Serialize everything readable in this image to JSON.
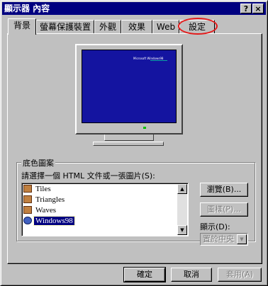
{
  "window": {
    "title": "顯示器 內容",
    "help_button": "?",
    "close_button": "×"
  },
  "tabs": [
    {
      "label": "背景",
      "active": true
    },
    {
      "label": "螢幕保護裝置"
    },
    {
      "label": "外觀"
    },
    {
      "label": "效果"
    },
    {
      "label": "Web"
    },
    {
      "label": "設定",
      "highlighted": true
    }
  ],
  "preview": {
    "screen_text": "Microsoft Windows98"
  },
  "wallpaper": {
    "group_label": "底色圖案",
    "prompt": "請選擇一個 HTML 文件或一張圖片(S):",
    "items": [
      {
        "label": "Tiles"
      },
      {
        "label": "Triangles"
      },
      {
        "label": "Waves"
      },
      {
        "label": "Windows98",
        "selected": true
      }
    ],
    "browse_button": "瀏覽(B)...",
    "pattern_button": "圖樣(P)...",
    "display_label": "顯示(D):",
    "display_value": "置於中央"
  },
  "footer": {
    "ok": "確定",
    "cancel": "取消",
    "apply": "套用(A)"
  },
  "colors": {
    "title_bar": "#000080",
    "desktop_preview": "#1414a0",
    "annotation": "#e41a1a"
  }
}
